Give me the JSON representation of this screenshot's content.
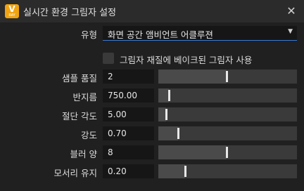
{
  "window": {
    "title": "실시간 환경 그림자 설정",
    "icon_letter": "V",
    "icon_sub": "RAY",
    "close": "✕"
  },
  "type": {
    "label": "유형",
    "value": "화면 공간 앰비언트 어클루젼",
    "arrow": "▼"
  },
  "bake": {
    "label": "그림자 재질에 베이크된 그림자 사용",
    "checked": false
  },
  "params": [
    {
      "id": "sample-quality",
      "label": "샘플 품질",
      "value": "2",
      "fraction": 0.49
    },
    {
      "id": "radius",
      "label": "반지름",
      "value": "750.00",
      "fraction": 0.075
    },
    {
      "id": "cutoff-angle",
      "label": "절단 각도",
      "value": "5.00",
      "fraction": 0.055
    },
    {
      "id": "intensity",
      "label": "강도",
      "value": "0.70",
      "fraction": 0.14
    },
    {
      "id": "blur-amount",
      "label": "블러 양",
      "value": "8",
      "fraction": 0.49
    },
    {
      "id": "edge-preserve",
      "label": "모서리 유지",
      "value": "0.20",
      "fraction": 0.195
    }
  ]
}
